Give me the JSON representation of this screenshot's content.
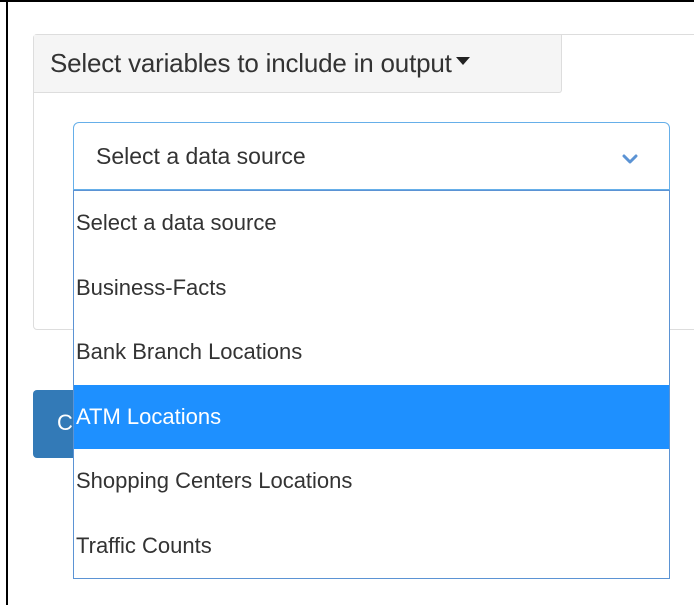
{
  "panel": {
    "header_label": "Select variables to include in output"
  },
  "select": {
    "current_value": "Select a data source",
    "options": [
      {
        "label": "Select a data source",
        "selected": false
      },
      {
        "label": "Business-Facts",
        "selected": false
      },
      {
        "label": "Bank Branch Locations",
        "selected": false
      },
      {
        "label": "ATM Locations",
        "selected": true
      },
      {
        "label": "Shopping Centers Locations",
        "selected": false
      },
      {
        "label": "Traffic Counts",
        "selected": false
      }
    ]
  },
  "button": {
    "visible_label": "C"
  },
  "colors": {
    "highlight": "#1e90ff",
    "focus_border": "#66afe9",
    "button": "#337ab7",
    "header_bg": "#f5f5f5"
  },
  "icons": {
    "caret": "caret-down-icon",
    "chevron": "chevron-down-icon"
  }
}
